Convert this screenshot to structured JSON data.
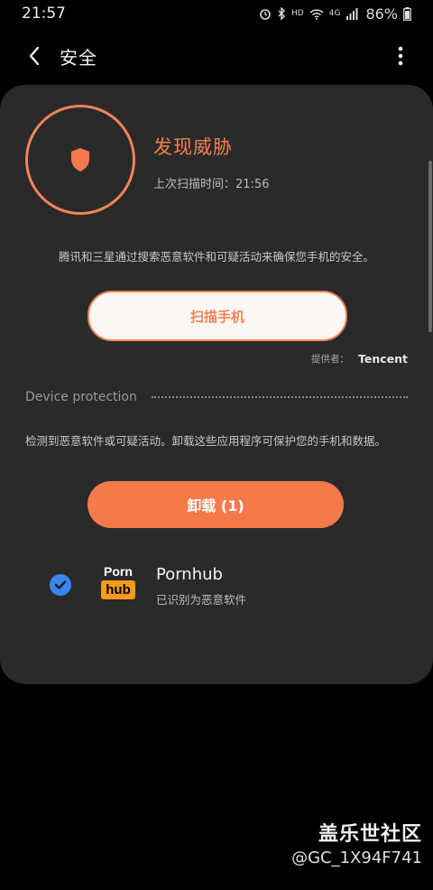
{
  "status_bar": {
    "time": "21:57",
    "network": "HD",
    "mobile": "4G",
    "battery": "86%"
  },
  "app_bar": {
    "title": "安全",
    "back_icon": "back-arrow-icon",
    "more_icon": "more-vert-icon"
  },
  "threat": {
    "title": "发现威胁",
    "scan_label": "上次扫描时间：",
    "scan_time": "21:56",
    "accent": "#f6804f"
  },
  "description": "腾讯和三星通过搜索恶意软件和可疑活动来确保您手机的安全。",
  "scan_button": "扫描手机",
  "provider": {
    "label": "提供者：",
    "name": "Tencent"
  },
  "device_protection": {
    "title": "Device protection",
    "description": "检测到恶意软件或可疑活动。卸载这些应用程序可保护您的手机和数据。",
    "uninstall_label": "卸载 (1)"
  },
  "apps": [
    {
      "name": "Pornhub",
      "status": "已识别为恶意软件",
      "checked": true,
      "logo_top": "Porn",
      "logo_bottom": "hub"
    }
  ],
  "watermark": {
    "line1": "盖乐世社区",
    "line2": "@GC_1X94F741"
  },
  "colors": {
    "accent": "#f47a4b",
    "card": "#2a2a2a",
    "check": "#3a86f0"
  }
}
